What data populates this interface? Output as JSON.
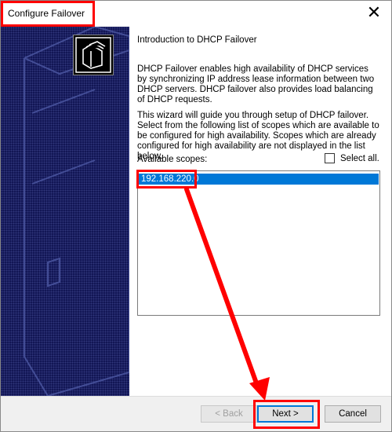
{
  "window": {
    "title": "Configure Failover",
    "close_glyph": "✕"
  },
  "intro": {
    "heading": "Introduction to DHCP Failover",
    "paragraph1": "DHCP Failover enables high availability of DHCP services by synchronizing IP address lease information between two DHCP servers. DHCP failover also provides load balancing of DHCP requests.",
    "paragraph2": "This wizard will guide you through setup of DHCP failover. Select from the following list of scopes which are available to be configured for high availability. Scopes which are already configured for high availability are not displayed in the list below."
  },
  "scopes": {
    "label": "Available scopes:",
    "select_all_label": "Select all.",
    "select_all_checked": false,
    "items": [
      {
        "value": "192.168.220.0",
        "selected": true
      }
    ]
  },
  "buttons": {
    "back": "< Back",
    "next": "Next >",
    "cancel": "Cancel"
  },
  "colors": {
    "side_panel": "#111554",
    "selection": "#0078d7",
    "annotation": "#ff0000"
  }
}
